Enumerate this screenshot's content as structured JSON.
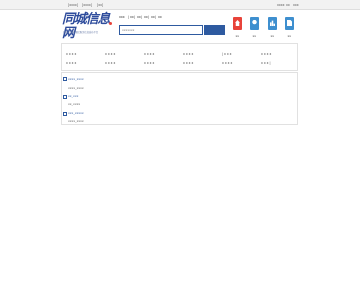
{
  "topbar": {
    "left_links": [
      "[xxxx]",
      "[xxxx]",
      "[xx]"
    ],
    "right_links": [
      "xxxx",
      "xx",
      "xxx"
    ]
  },
  "logo": {
    "main": "同城信息网",
    "sub": "同城信息网·便民服务信息发布平台"
  },
  "city_bar": {
    "items": [
      "xxx",
      "|",
      "xx",
      "|",
      "xx",
      "|",
      "xx",
      "|",
      "xx",
      "|",
      "xx"
    ]
  },
  "search": {
    "placeholder": "xxxxxxx"
  },
  "nav": [
    {
      "label": "xx",
      "color": "#e8433a"
    },
    {
      "label": "xx",
      "color": "#3e8fcf"
    },
    {
      "label": "xx",
      "color": "#3e8fcf"
    },
    {
      "label": "xx",
      "color": "#3e8fcf"
    }
  ],
  "categories": [
    {
      "row1": "x x x x",
      "row2": "x x x x"
    },
    {
      "row1": "x x x x",
      "row2": "x x x x"
    },
    {
      "row1": "x x x x",
      "row2": "x x x x"
    },
    {
      "row1": "x x x x",
      "row2": "x x x x"
    },
    {
      "row1": "| x x x",
      "row2": "x x x x"
    },
    {
      "row1": "x x x x",
      "row2": "x x x |"
    }
  ],
  "list_items": [
    {
      "title": "xxxx_xxxx",
      "sub": "xxxx_xxxx"
    },
    {
      "title": "xx_xxx",
      "sub": "xx_xxxx"
    },
    {
      "title": "xxx_xxxxx",
      "sub": "xxxx_xxxx"
    }
  ]
}
